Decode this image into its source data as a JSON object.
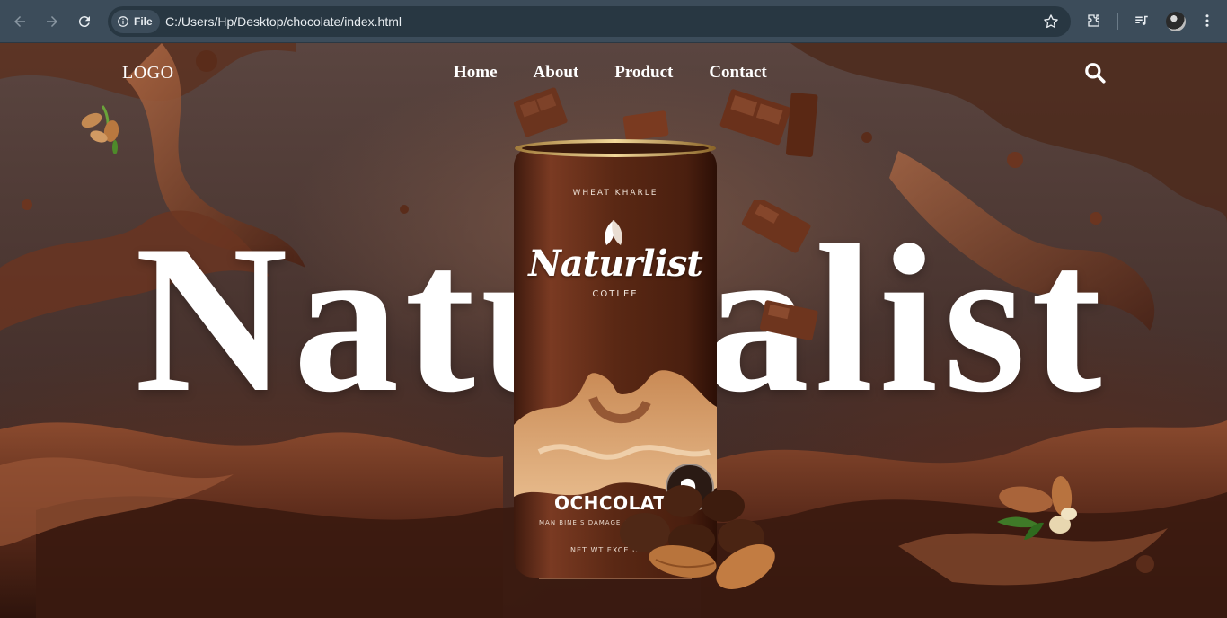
{
  "browser": {
    "site_chip": "File",
    "url": "C:/Users/Hp/Desktop/chocolate/index.html"
  },
  "header": {
    "logo": "LOGO",
    "nav": [
      "Home",
      "About",
      "Product",
      "Contact"
    ]
  },
  "hero": {
    "title": "Naturalist"
  },
  "product": {
    "top_text": "WHEAT KHARLE",
    "brand": "Naturlist",
    "sub": "COTLEE",
    "flavor": "OCHCOLATE",
    "fine_print_1": "MAN BINE S DAMAGE ALE",
    "fine_print_2": "NET WT EXCE DALS"
  },
  "colors": {
    "chrome_bg": "#3c4c5a",
    "omnibox_bg": "#283742",
    "chocolate_dark": "#3b2420",
    "chocolate_mid": "#6b3a26",
    "text": "#ffffff"
  }
}
